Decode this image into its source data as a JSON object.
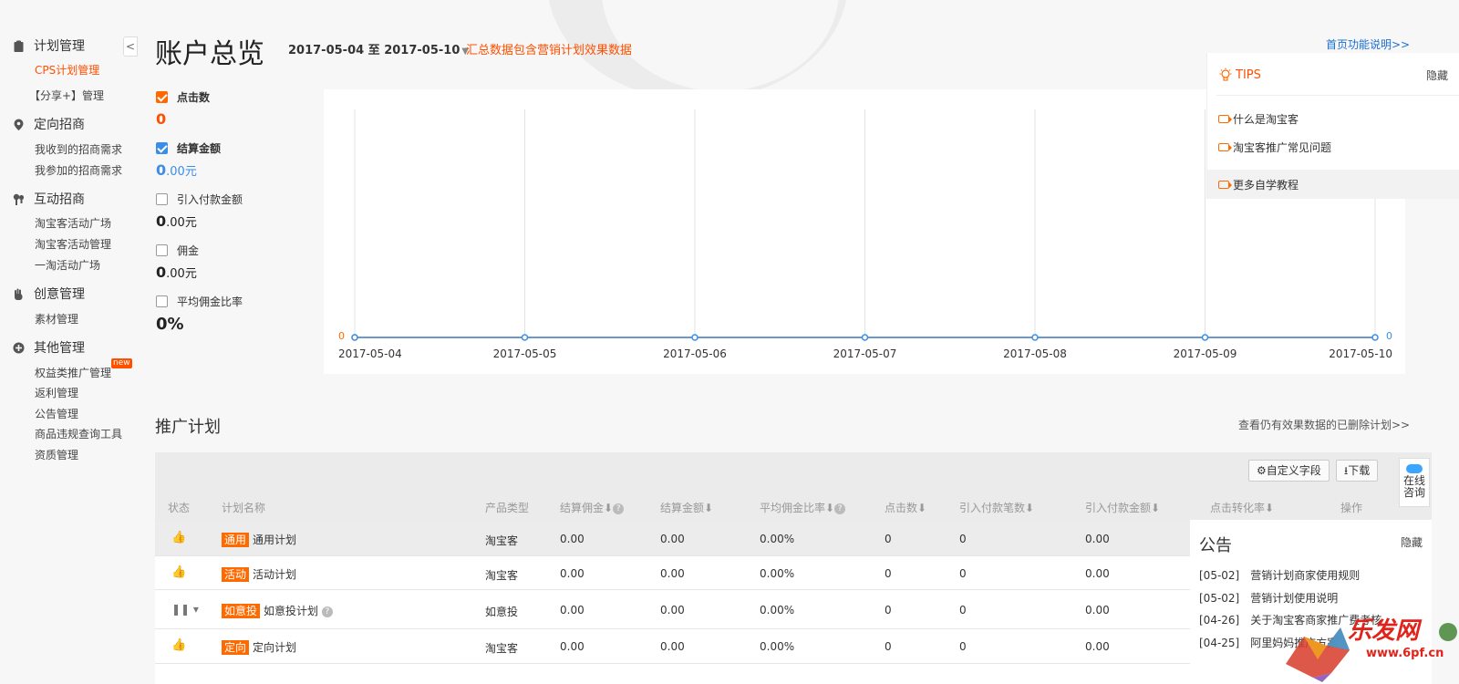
{
  "sidebar": {
    "collapse_glyph": "<",
    "sections": [
      {
        "title": "计划管理",
        "icon": "clipboard-icon",
        "items": [
          {
            "label": "CPS计划管理",
            "active": true
          },
          {
            "label": "【分享+】管理"
          }
        ]
      },
      {
        "title": "定向招商",
        "icon": "location-pin-icon",
        "items": [
          {
            "label": "我收到的招商需求"
          },
          {
            "label": "我参加的招商需求"
          }
        ]
      },
      {
        "title": "互动招商",
        "icon": "interaction-icon",
        "items": [
          {
            "label": "淘宝客活动广场"
          },
          {
            "label": "淘宝客活动管理"
          },
          {
            "label": "一淘活动广场"
          }
        ]
      },
      {
        "title": "创意管理",
        "icon": "hand-icon",
        "items": [
          {
            "label": "素材管理"
          }
        ]
      },
      {
        "title": "其他管理",
        "icon": "plus-circle-icon",
        "items": [
          {
            "label": "权益类推广管理",
            "badge": "new"
          },
          {
            "label": "返利管理"
          },
          {
            "label": "公告管理"
          },
          {
            "label": "商品违规查询工具"
          },
          {
            "label": "资质管理"
          }
        ]
      }
    ]
  },
  "header": {
    "title": "账户总览",
    "date_range": "2017-05-04 至 2017-05-10",
    "summary_note": "汇总数据包含营销计划效果数据",
    "help_link": "首页功能说明>>"
  },
  "metrics": [
    {
      "label": "点击数",
      "value": "0",
      "unit": "",
      "checked": true,
      "color": "#ff6a00"
    },
    {
      "label": "结算金额",
      "value": "0",
      "unit": ".00元",
      "checked": true,
      "color": "#3b8ee8"
    },
    {
      "label": "引入付款金额",
      "value": "0",
      "unit": ".00元",
      "checked": false
    },
    {
      "label": "佣金",
      "value": "0",
      "unit": ".00元",
      "checked": false
    },
    {
      "label": "平均佣金比率",
      "value": "0%",
      "unit": "",
      "checked": false
    }
  ],
  "chart_data": {
    "type": "line",
    "x": [
      "2017-05-04",
      "2017-05-05",
      "2017-05-06",
      "2017-05-07",
      "2017-05-08",
      "2017-05-09",
      "2017-05-10"
    ],
    "series": [
      {
        "values": [
          0,
          0,
          0,
          0,
          0,
          0,
          0
        ],
        "color": "#ff6a00"
      },
      {
        "values": [
          0,
          0,
          0,
          0,
          0,
          0,
          0
        ],
        "color": "#3b8ee8"
      }
    ],
    "y_left_label": "0",
    "y_right_label": "0"
  },
  "tips": {
    "title": "TIPS",
    "hide": "隐藏",
    "items": [
      "什么是淘宝客",
      "淘宝客推广常见问题",
      "更多自学教程"
    ]
  },
  "plans": {
    "title": "推广计划",
    "deleted_link": "查看仍有效果数据的已删除计划>>",
    "custom_fields": "自定义字段",
    "download": "下载",
    "columns": [
      "状态",
      "计划名称",
      "产品类型",
      "结算佣金",
      "结算金额",
      "平均佣金比率",
      "点击数",
      "引入付款笔数",
      "引入付款金额",
      "点击转化率",
      "操作"
    ],
    "rows": [
      {
        "tag": "通用",
        "name": "通用计划",
        "type": "淘宝客",
        "commission": "0.00",
        "amount": "0.00",
        "ratio": "0.00%",
        "clicks": "0",
        "orders": "0",
        "pay_amount": "0.00"
      },
      {
        "tag": "活动",
        "name": "活动计划",
        "type": "淘宝客",
        "commission": "0.00",
        "amount": "0.00",
        "ratio": "0.00%",
        "clicks": "0",
        "orders": "0",
        "pay_amount": "0.00"
      },
      {
        "tag": "如意投",
        "name": "如意投计划",
        "type": "如意投",
        "commission": "0.00",
        "amount": "0.00",
        "ratio": "0.00%",
        "clicks": "0",
        "orders": "0",
        "pay_amount": "0.00"
      },
      {
        "tag": "定向",
        "name": "定向计划",
        "type": "淘宝客",
        "commission": "0.00",
        "amount": "0.00",
        "ratio": "0.00%",
        "clicks": "0",
        "orders": "0",
        "pay_amount": "0.00"
      }
    ]
  },
  "notice": {
    "title": "公告",
    "hide": "隐藏",
    "items": [
      {
        "date": "[05-02]",
        "text": "营销计划商家使用规则"
      },
      {
        "date": "[05-02]",
        "text": "营销计划使用说明"
      },
      {
        "date": "[04-26]",
        "text": "关于淘宝客商家推广费考核"
      },
      {
        "date": "[04-25]",
        "text": "阿里妈妈推广方案"
      }
    ]
  },
  "consult": {
    "line1": "在线",
    "line2": "咨询"
  },
  "watermark": {
    "text": "乐发网",
    "url": "www.6pf.cn"
  },
  "colors": {
    "accent": "#ff5000",
    "link": "#1a6fd1",
    "blue": "#3b8ee8"
  }
}
